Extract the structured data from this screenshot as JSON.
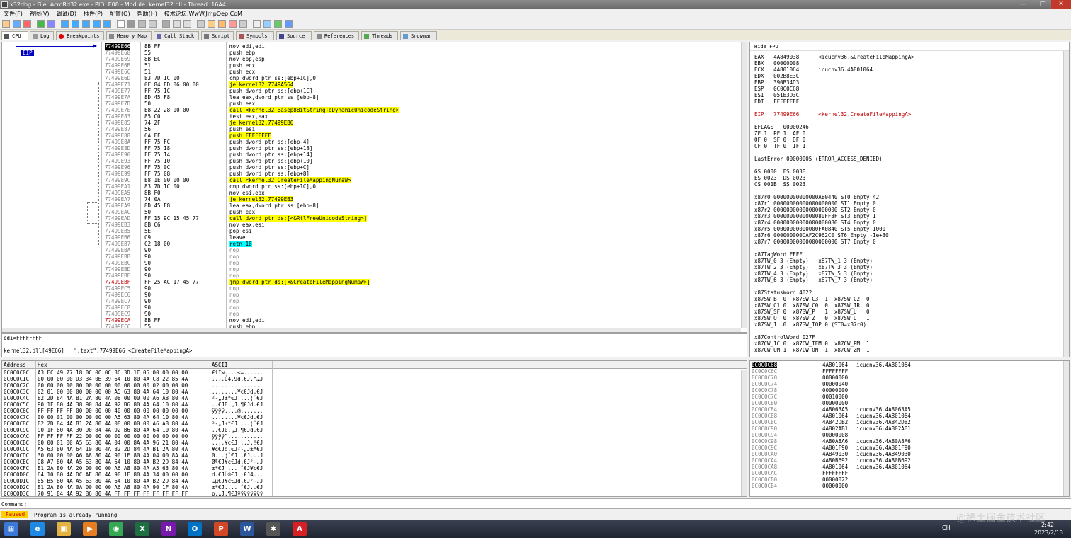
{
  "window": {
    "title": "x32dbg - File: AcroRd32.exe - PID: E08 - Module: kernel32.dll - Thread: 16A4",
    "min": "—",
    "max": "□",
    "close": "✕"
  },
  "menu": [
    "文件(F)",
    "视图(V)",
    "调试(D)",
    "插件(P)",
    "配置(O)",
    "帮助(H)",
    "技术论坛:WwW.JmpOep.CoM"
  ],
  "tabs": [
    {
      "label": "CPU",
      "icon": "cpu-icon",
      "color": "#555"
    },
    {
      "label": "Log",
      "icon": "log-icon",
      "color": "#999"
    },
    {
      "label": "Breakpoints",
      "icon": "breakpoint-icon",
      "color": "#d00"
    },
    {
      "label": "Memory Map",
      "icon": "memory-map-icon",
      "color": "#888"
    },
    {
      "label": "Call Stack",
      "icon": "call-stack-icon",
      "color": "#66a"
    },
    {
      "label": "Script",
      "icon": "script-icon",
      "color": "#777"
    },
    {
      "label": "Symbols",
      "icon": "symbols-icon",
      "color": "#a55"
    },
    {
      "label": "Source",
      "icon": "source-icon",
      "color": "#448"
    },
    {
      "label": "References",
      "icon": "references-icon",
      "color": "#888"
    },
    {
      "label": "Threads",
      "icon": "threads-icon",
      "color": "#5a5"
    },
    {
      "label": "Snowman",
      "icon": "snowman-icon",
      "color": "#69c"
    }
  ],
  "cpu": {
    "eip_label": "EIP",
    "rows": [
      {
        "addr": "77499E66",
        "bytes": "8B FF",
        "dis": "mov edi,edi",
        "addrStyle": "sel"
      },
      {
        "addr": "77499E68",
        "bytes": "55",
        "dis": "push ebp"
      },
      {
        "addr": "77499E69",
        "bytes": "8B EC",
        "dis": "mov ebp,esp"
      },
      {
        "addr": "77499E6B",
        "bytes": "51",
        "dis": "push ecx"
      },
      {
        "addr": "77499E6C",
        "bytes": "51",
        "dis": "push ecx"
      },
      {
        "addr": "77499E6D",
        "bytes": "83 7D 1C 00",
        "dis": "cmp dword ptr ss:[ebp+1C],0"
      },
      {
        "addr": "77499E71",
        "bytes": "0F 84 ED 06 00 00",
        "dis": "je kernel32.7749A564",
        "disStyle": "yellow"
      },
      {
        "addr": "77499E77",
        "bytes": "FF 75 1C",
        "dis": "push dword ptr ss:[ebp+1C]"
      },
      {
        "addr": "77499E7A",
        "bytes": "8D 45 F8",
        "dis": "lea eax,dword ptr ss:[ebp-8]"
      },
      {
        "addr": "77499E7D",
        "bytes": "50",
        "dis": "push eax"
      },
      {
        "addr": "77499E7E",
        "bytes": "E8 22 28 00 00",
        "dis": "call <kernel32.Basep8BitStringToDynamicUnicodeString>",
        "disStyle": "call"
      },
      {
        "addr": "77499E83",
        "bytes": "85 C0",
        "dis": "test eax,eax"
      },
      {
        "addr": "77499E85",
        "bytes": "74 2F",
        "dis": "je kernel32.77499EB6",
        "disStyle": "yellow"
      },
      {
        "addr": "77499E87",
        "bytes": "56",
        "dis": "push esi"
      },
      {
        "addr": "77499E88",
        "bytes": "6A FF",
        "dis": "push FFFFFFFF",
        "disStyle": "yellow"
      },
      {
        "addr": "77499E8A",
        "bytes": "FF 75 FC",
        "dis": "push dword ptr ss:[ebp-4]"
      },
      {
        "addr": "77499E8D",
        "bytes": "FF 75 18",
        "dis": "push dword ptr ss:[ebp+18]"
      },
      {
        "addr": "77499E90",
        "bytes": "FF 75 14",
        "dis": "push dword ptr ss:[ebp+14]"
      },
      {
        "addr": "77499E93",
        "bytes": "FF 75 10",
        "dis": "push dword ptr ss:[ebp+10]"
      },
      {
        "addr": "77499E96",
        "bytes": "FF 75 0C",
        "dis": "push dword ptr ss:[ebp+C]"
      },
      {
        "addr": "77499E99",
        "bytes": "FF 75 08",
        "dis": "push dword ptr ss:[ebp+8]"
      },
      {
        "addr": "77499E9C",
        "bytes": "E8 1E 00 00 00",
        "dis": "call <kernel32.CreateFileMappingNumaW>",
        "disStyle": "call"
      },
      {
        "addr": "77499EA1",
        "bytes": "83 7D 1C 00",
        "dis": "cmp dword ptr ss:[ebp+1C],0"
      },
      {
        "addr": "77499EA5",
        "bytes": "8B F0",
        "dis": "mov esi,eax"
      },
      {
        "addr": "77499EA7",
        "bytes": "74 0A",
        "dis": "je kernel32.77499EB3",
        "disStyle": "yellow"
      },
      {
        "addr": "77499EA9",
        "bytes": "8D 45 F8",
        "dis": "lea eax,dword ptr ss:[ebp-8]"
      },
      {
        "addr": "77499EAC",
        "bytes": "50",
        "dis": "push eax"
      },
      {
        "addr": "77499EAD",
        "bytes": "FF 15 9C 15 45 77",
        "dis": "call dword ptr ds:[<&RtlFreeUnicodeString>]",
        "disStyle": "call"
      },
      {
        "addr": "77499EB3",
        "bytes": "8B C6",
        "dis": "mov eax,esi"
      },
      {
        "addr": "77499EB5",
        "bytes": "5E",
        "dis": "pop esi"
      },
      {
        "addr": "77499EB6",
        "bytes": "C9",
        "dis": "leave"
      },
      {
        "addr": "77499EB7",
        "bytes": "C2 18 00",
        "dis": "retn 18",
        "disStyle": "ret"
      },
      {
        "addr": "77499EBA",
        "bytes": "90",
        "dis": "nop",
        "disStyle": "gray"
      },
      {
        "addr": "77499EBB",
        "bytes": "90",
        "dis": "nop",
        "disStyle": "gray"
      },
      {
        "addr": "77499EBC",
        "bytes": "90",
        "dis": "nop",
        "disStyle": "gray"
      },
      {
        "addr": "77499EBD",
        "bytes": "90",
        "dis": "nop",
        "disStyle": "gray"
      },
      {
        "addr": "77499EBE",
        "bytes": "90",
        "dis": "nop",
        "disStyle": "gray"
      },
      {
        "addr": "77499EBF",
        "bytes": "FF 25 AC 17 45 77",
        "dis": "jmp dword ptr ds:[<&CreateFileMappingNumaW>]",
        "disStyle": "yellow",
        "addrStyle": "red"
      },
      {
        "addr": "77499EC5",
        "bytes": "90",
        "dis": "nop",
        "disStyle": "gray"
      },
      {
        "addr": "77499EC6",
        "bytes": "90",
        "dis": "nop",
        "disStyle": "gray"
      },
      {
        "addr": "77499EC7",
        "bytes": "90",
        "dis": "nop",
        "disStyle": "gray"
      },
      {
        "addr": "77499EC8",
        "bytes": "90",
        "dis": "nop",
        "disStyle": "gray"
      },
      {
        "addr": "77499EC9",
        "bytes": "90",
        "dis": "nop",
        "disStyle": "gray"
      },
      {
        "addr": "77499ECA",
        "bytes": "8B FF",
        "dis": "mov edi,edi",
        "addrStyle": "red"
      },
      {
        "addr": "77499ECC",
        "bytes": "55",
        "dis": "push ebp"
      }
    ],
    "info1": "edi=FFFFFFFF",
    "info2": "kernel32.dll[49E66] | \".text\":77499E66 <CreateFileMappingA>"
  },
  "regs": {
    "header": "Hide FPU",
    "lines": [
      "EAX   4A849038      <icucnv36.&CreateFileMappingA>",
      "EBX   00000008",
      "ECX   4A801064      icucnv36.4A801064",
      "EDX   002B8E3C",
      "EBP   390B34D3",
      "ESP   0C0C0C68",
      "ESI   051E3D3C",
      "EDI   FFFFFFFF",
      "",
      "EIP   77499E66      <kernel32.CreateFileMappingA>",
      "",
      "EFLAGS   00000246",
      "ZF 1  PF 1  AF 0",
      "OF 0  SF 0  DF 0",
      "CF 0  TF 0  IF 1",
      "",
      "LastError 00000005 (ERROR_ACCESS_DENIED)",
      "",
      "GS 0000  FS 003B",
      "ES 0023  DS 0023",
      "CS 001B  SS 0023",
      "",
      "x87r0 00000000000000A80440 ST0 Empty 42",
      "x87r1 00000000000000000000 ST1 Empty 0",
      "x87r2 00000000000000000000 ST2 Empty 0",
      "x87r3 0000000000000080FF3F ST3 Empty 1",
      "x87r4 00000000000000000080 ST4 Empty 0",
      "x87r5 00000000000000FA0840 ST5 Empty 1000",
      "x87r6 000000000CAF2C962C0 ST6 Empty -1e+30",
      "x87r7 00000000000000000000 ST7 Empty 0",
      "",
      "x87TagWord FFFF",
      "x87TW_0 3 (Empty)   x87TW_1 3 (Empty)",
      "x87TW_2 3 (Empty)   x87TW_3 3 (Empty)",
      "x87TW_4 3 (Empty)   x87TW_5 3 (Empty)",
      "x87TW_6 3 (Empty)   x87TW_7 3 (Empty)",
      "",
      "x87StatusWord 4022",
      "x87SW_B  0  x87SW_C3  1  x87SW_C2  0",
      "x87SW_C1 0  x87SW_C0  0  x87SW_IR  0",
      "x87SW_SF 0  x87SW_P   1  x87SW_U   0",
      "x87SW_O  0  x87SW_Z   0  x87SW_D   1",
      "x87SW_I  0  x87SW_TOP 0 (ST0=x87r0)",
      "",
      "x87ControlWord 027F",
      "x87CW_IC 0  x87CW_IEM 0  x87CW_PM  1",
      "x87CW_UM 1  x87CW_OM  1  x87CW_ZM  1"
    ]
  },
  "dump": {
    "headers": {
      "addr": "Address",
      "hex": "Hex",
      "ascii": "ASCII"
    },
    "rows": [
      {
        "addr": "0C0C0C0C",
        "hex": "A3 EC 49 77 18 0C 0C 0C 3C 3D 1E 05 00 00 00 00",
        "ascii": "£ìIw....<=......"
      },
      {
        "addr": "0C0C0C1C",
        "hex": "00 00 00 00 D3 34 0B 39 64 10 80 4A C8 22 85 4A",
        "ascii": "....Ó4.9d.€J.\"…J"
      },
      {
        "addr": "0C0C0C2C",
        "hex": "00 00 00 10 00 00 00 00 00 00 00 00 02 00 00 00",
        "ascii": "................"
      },
      {
        "addr": "0C0C0C3C",
        "hex": "02 01 00 00 00 00 00 00 A5 63 80 4A 64 10 80 4A",
        "ascii": "........¥c€Jd.€J"
      },
      {
        "addr": "0C0C0C4C",
        "hex": "B2 2D 84 4A B1 2A 80 4A 08 00 00 00 A6 A8 80 4A",
        "ascii": "²-„J±*€J....¦¨€J"
      },
      {
        "addr": "0C0C0C5C",
        "hex": "90 1F 80 4A 38 90 84 4A 92 B6 80 4A 64 10 80 4A",
        "ascii": "..€J8.„J.¶€Jd.€J"
      },
      {
        "addr": "0C0C0C6C",
        "hex": "FF FF FF FF 00 00 00 00 40 00 00 00 00 00 00 00",
        "ascii": "ÿÿÿÿ....@......."
      },
      {
        "addr": "0C0C0C7C",
        "hex": "00 00 01 00 00 00 00 00 A5 63 80 4A 64 10 80 4A",
        "ascii": "........¥c€Jd.€J"
      },
      {
        "addr": "0C0C0C8C",
        "hex": "B2 2D 84 4A B1 2A 80 4A 08 00 00 00 A6 A8 80 4A",
        "ascii": "²-„J±*€J....¦¨€J"
      },
      {
        "addr": "0C0C0C9C",
        "hex": "90 1F 80 4A 30 90 84 4A 92 B6 80 4A 64 10 80 4A",
        "ascii": "..€J0.„J.¶€Jd.€J"
      },
      {
        "addr": "0C0C0CAC",
        "hex": "FF FF FF FF 22 00 00 00 00 00 00 00 00 00 00 00",
        "ascii": "ÿÿÿÿ\"..........."
      },
      {
        "addr": "0C0C0CBC",
        "hex": "00 00 01 00 A5 63 80 4A 04 00 8A 4A 96 21 80 4A",
        "ascii": "....¥c€J...J.!€J"
      },
      {
        "addr": "0C0C0CCC",
        "hex": "A5 63 80 4A 64 10 80 4A B2 2D 84 4A B1 2A 80 4A",
        "ascii": "¥c€Jd.€J²-„J±*€J"
      },
      {
        "addr": "0C0C0CDC",
        "hex": "30 00 00 00 A6 A8 80 4A 90 1F 80 4A 04 00 8A 4A",
        "ascii": "0...¦¨€J..€J...J"
      },
      {
        "addr": "0C0C0CEC",
        "hex": "D8 A7 80 4A A5 63 80 4A 64 10 80 4A B2 2D 84 4A",
        "ascii": "Ø§€J¥c€Jd.€J²-„J"
      },
      {
        "addr": "0C0C0CFC",
        "hex": "B1 2A 80 4A 20 00 00 00 A6 A8 80 4A A5 63 80 4A",
        "ascii": "±*€J ...¦¨€J¥c€J"
      },
      {
        "addr": "0C0C0D0C",
        "hex": "64 10 80 4A DC AE 80 4A 90 1F 80 4A 34 00 00 00",
        "ascii": "d.€JÜ®€J..€J4..."
      },
      {
        "addr": "0C0C0D1C",
        "hex": "85 B5 80 4A A5 63 80 4A 64 10 80 4A B2 2D 84 4A",
        "ascii": "…µ€J¥c€Jd.€J²-„J"
      },
      {
        "addr": "0C0C0D2C",
        "hex": "B1 2A 80 4A 0A 00 00 00 A6 A8 80 4A 90 1F 80 4A",
        "ascii": "±*€J....¦¨€J..€J"
      },
      {
        "addr": "0C0C0D3C",
        "hex": "70 91 84 4A 92 B6 80 4A FF FF FF FF FF FF FF FF",
        "ascii": "p.„J.¶€Jÿÿÿÿÿÿÿÿ"
      }
    ]
  },
  "stack": {
    "rows": [
      {
        "addr": "0C0C0C68",
        "val": "4A801064",
        "cmt": "icucnv36.4A801064",
        "sel": true
      },
      {
        "addr": "0C0C0C6C",
        "val": "FFFFFFFF",
        "cmt": ""
      },
      {
        "addr": "0C0C0C70",
        "val": "00000000",
        "cmt": ""
      },
      {
        "addr": "0C0C0C74",
        "val": "00000040",
        "cmt": ""
      },
      {
        "addr": "0C0C0C78",
        "val": "00000000",
        "cmt": ""
      },
      {
        "addr": "0C0C0C7C",
        "val": "00010000",
        "cmt": ""
      },
      {
        "addr": "0C0C0C80",
        "val": "00000000",
        "cmt": ""
      },
      {
        "addr": "0C0C0C84",
        "val": "4A8063A5",
        "cmt": "icucnv36.4A8063A5"
      },
      {
        "addr": "0C0C0C88",
        "val": "4A801064",
        "cmt": "icucnv36.4A801064"
      },
      {
        "addr": "0C0C0C8C",
        "val": "4A842DB2",
        "cmt": "icucnv36.4A842DB2"
      },
      {
        "addr": "0C0C0C90",
        "val": "4A802AB1",
        "cmt": "icucnv36.4A802AB1"
      },
      {
        "addr": "0C0C0C94",
        "val": "00000008",
        "cmt": ""
      },
      {
        "addr": "0C0C0C98",
        "val": "4A80A8A6",
        "cmt": "icucnv36.4A80A8A6"
      },
      {
        "addr": "0C0C0C9C",
        "val": "4A801F90",
        "cmt": "icucnv36.4A801F90"
      },
      {
        "addr": "0C0C0CA0",
        "val": "4A849030",
        "cmt": "icucnv36.4A849030"
      },
      {
        "addr": "0C0C0CA4",
        "val": "4A80B692",
        "cmt": "icucnv36.4A80B692"
      },
      {
        "addr": "0C0C0CA8",
        "val": "4A801064",
        "cmt": "icucnv36.4A801064"
      },
      {
        "addr": "0C0C0CAC",
        "val": "FFFFFFFF",
        "cmt": ""
      },
      {
        "addr": "0C0C0CB0",
        "val": "00000022",
        "cmt": ""
      },
      {
        "addr": "0C0C0CB4",
        "val": "00000000",
        "cmt": ""
      }
    ]
  },
  "command": {
    "label": "Command:",
    "value": ""
  },
  "status": {
    "state": "Paused",
    "message": "Program is already running",
    "state_color": "#ffd000"
  },
  "taskbar": {
    "apps": [
      {
        "name": "start-icon",
        "glyph": "⊞",
        "color": "#3b78d8"
      },
      {
        "name": "ie-icon",
        "glyph": "e",
        "color": "#1e88e5"
      },
      {
        "name": "explorer-icon",
        "glyph": "▣",
        "color": "#e3b341"
      },
      {
        "name": "media-player-icon",
        "glyph": "▶",
        "color": "#e67e22"
      },
      {
        "name": "chrome-icon",
        "glyph": "◉",
        "color": "#34a853"
      },
      {
        "name": "excel-icon",
        "glyph": "X",
        "color": "#1d6f42"
      },
      {
        "name": "onenote-icon",
        "glyph": "N",
        "color": "#7719aa"
      },
      {
        "name": "outlook-icon",
        "glyph": "O",
        "color": "#0072c6"
      },
      {
        "name": "powerpoint-icon",
        "glyph": "P",
        "color": "#d24726"
      },
      {
        "name": "word-icon",
        "glyph": "W",
        "color": "#2b579a"
      },
      {
        "name": "x32dbg-icon",
        "glyph": "✱",
        "color": "#555"
      },
      {
        "name": "acrobat-icon",
        "glyph": "A",
        "color": "#d71f26"
      }
    ],
    "lang": "CH",
    "time": "2:42",
    "date": "2023/2/13",
    "watermark": "@稀土掘金技术社区"
  }
}
